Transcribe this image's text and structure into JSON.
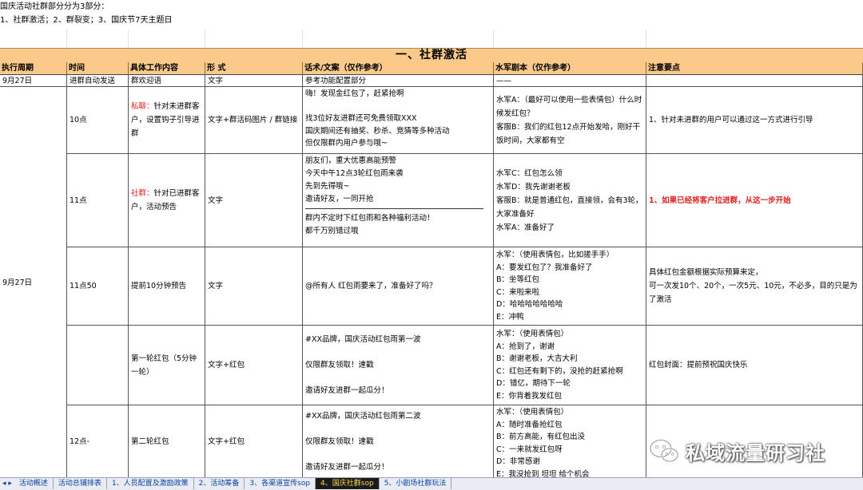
{
  "intro": {
    "line1": "国庆活动社群部分分为3部分：",
    "line2": "1、社群激活；2、群裂变；3、国庆节7天主题日"
  },
  "section_title": "一、社群激活",
  "columns": [
    "执行周期",
    "时间",
    "具体工作内容",
    "形  式",
    "话术/文案（仅作参考）",
    "水军剧本（仅作参考）",
    "注意要点"
  ],
  "rows": {
    "r0": {
      "period": "9月27日",
      "time": "进群自动发送",
      "work": "群欢迎语",
      "form": "文字",
      "script": "参考功能配置部分",
      "army": "——",
      "note": ""
    },
    "r1": {
      "time": "10点",
      "work_prefix": "私聊：",
      "work": "针对未进群客户，设置钩子引导进群",
      "form": "文字+群活码图片 / 群链接",
      "script": "嗨！发现金红包了，赶紧抢啊\n\n找3位好友进群还可免费领取XXX\n国庆期间还有抽奖、秒杀、竞猜等多种活动\n但仅限群内用户参与哦~",
      "army": "水军A：（最好可以使用一些表情包）什么时候发红包？\n客服B：我们的红包12点开始发哈，刚好干饭时间，大家都有空",
      "note": "1、针对未进群的用户可以通过这一方式进行引导"
    },
    "r2": {
      "time": "11点",
      "work_prefix": "社群：",
      "work": "针对已进群客户，活动预告",
      "form": "文字",
      "script_top": "朋友们，重大优惠高能预警\n今天中午12点3轮红包雨来袭\n先到先得哦~\n邀请好友，一同开抢",
      "script_bottom": "群内不定时下红包雨和各种福利活动！\n都千万别错过哦",
      "army": "水军C：红包怎么领\n水军D：我先谢谢老板\n客服B：就是普通红包，直接领，会有3轮，大家准备好\n水军A：准备好了",
      "note": "1、如果已经将客户拉进群，从这一步开始"
    },
    "r3": {
      "time": "11点50",
      "work": "提前10分钟预告",
      "form": "文字",
      "script": "@所有人 红包雨要来了，准备好了吗？",
      "army": "水军：（使用表情包，比如搓手手）\nA：要发红包了？我准备好了\nB：坐等红包\nC：来啦来啦\nD：哈哈哈哈哈哈哈\nE：冲鸭",
      "note": "具体红包金额根据实际预算来定，\n可一次发10个、20个，一次5元、10元，不必多，目的只是为了激活"
    },
    "r4": {
      "work": "第一轮红包（5分钟一轮）",
      "form": "文字+红包",
      "script": "#XX品牌，国庆活动红包雨第一波\n\n仅限群友领取！速戳\n\n邀请好友进群一起瓜分！",
      "army": "水军：（使用表情包）\nA：抢到了，谢谢\nB：谢谢老板，大吉大利\nC：红包还有剩下的，没抢的赶紧抢啊\nD：错亿，期待下一轮\nE：你背着我发红包",
      "note": "红包封面：提前预祝国庆快乐"
    },
    "r5": {
      "time": "12点-",
      "work": "第二轮红包",
      "form": "文字+红包",
      "script": "#XX品牌，国庆活动红包雨第二波\n\n仅限群友领取！速戳\n\n邀请好友进群一起瓜分！",
      "army": "水军：（使用表情包）\nA：随时准备抢红包\nB：前方高能，有红包出没\nC：一来就发红包呀\nD：非常感谢\nE：我没抢到 坦坦 给个机会",
      "note": ""
    },
    "merged_period": "9月27日"
  },
  "tabs": [
    "活动概述",
    "活动总铺排表",
    "1、人员配置及激励政策",
    "2、活动筹备",
    "3、各渠道宣传sop",
    "4、国庆社群sop",
    "5、小剧场社群玩法"
  ],
  "active_tab": "4、国庆社群sop",
  "tab_nav": "◂ ▸",
  "watermark": {
    "text": "私域流量研习社",
    "icon": "wechat-icon"
  },
  "colors": {
    "header_bg": "#fbc98a",
    "accent_red": "#e02020",
    "active_tab_bg": "#1a1a1a",
    "active_tab_fg": "#ffd84a"
  }
}
